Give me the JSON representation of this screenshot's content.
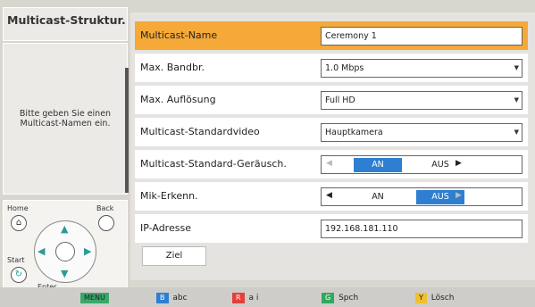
{
  "left": {
    "title": "Multicast-Struktur.",
    "help": "Bitte geben Sie einen Multicast-Namen ein.",
    "remote": {
      "home": "Home",
      "back": "Back",
      "start": "Start",
      "enter": "Enter"
    }
  },
  "rows": [
    {
      "label": "Multicast-Name",
      "value": "Ceremony 1",
      "kind": "text",
      "selected": true
    },
    {
      "label": "Max. Bandbr.",
      "value": "1.0 Mbps",
      "kind": "select"
    },
    {
      "label": "Max. Auflösung",
      "value": "Full HD",
      "kind": "select"
    },
    {
      "label": "Multicast-Standardvideo",
      "value": "Hauptkamera",
      "kind": "select"
    },
    {
      "label": "Multicast-Standard-Geräusch.",
      "on": "AN",
      "off": "AUS",
      "active": "on",
      "kind": "toggle"
    },
    {
      "label": "Mik-Erkenn.",
      "on": "AN",
      "off": "AUS",
      "active": "off",
      "kind": "toggle"
    },
    {
      "label": "IP-Adresse",
      "value": "192.168.181.110",
      "kind": "text"
    }
  ],
  "ziel_label": "Ziel",
  "bottom_keys": [
    {
      "chip": "MENU",
      "label": "",
      "color": "#3aa86a"
    },
    {
      "chip": "B",
      "label": "abc",
      "color": "#2e7fd1"
    },
    {
      "chip": "R",
      "label": "a i",
      "color": "#e2403a"
    },
    {
      "chip": "G",
      "label": "Spch",
      "color": "#32a860"
    },
    {
      "chip": "Y",
      "label": "Lösch",
      "color": "#f0c030"
    }
  ],
  "colors": {
    "selected": "#f4a938",
    "toggle_active": "#2e7fd1"
  }
}
